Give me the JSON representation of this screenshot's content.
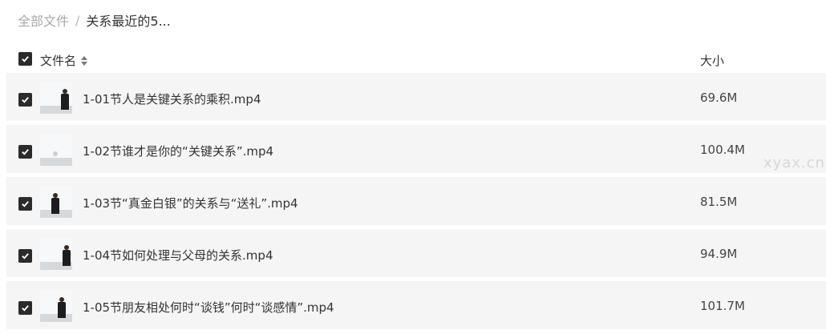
{
  "breadcrumb": {
    "root": "全部文件",
    "separator": "/",
    "current": "关系最近的5..."
  },
  "header": {
    "name_label": "文件名",
    "size_label": "大小",
    "all_checked": true
  },
  "files": [
    {
      "name": "1-01节人是关键关系的乘积.mp4",
      "size": "69.6M",
      "checked": true
    },
    {
      "name": "1-02节谁才是你的“关键关系”.mp4",
      "size": "100.4M",
      "checked": true
    },
    {
      "name": "1-03节“真金白银”的关系与“送礼”.mp4",
      "size": "81.5M",
      "checked": true
    },
    {
      "name": "1-04节如何处理与父母的关系.mp4",
      "size": "94.9M",
      "checked": true
    },
    {
      "name": "1-05节朋友相处何时“谈钱”何时“谈感情”.mp4",
      "size": "101.7M",
      "checked": true
    }
  ],
  "watermark": "xyax.cn",
  "colors": {
    "row_bg": "#f5f5f6",
    "checkbox": "#2b2b2b",
    "breadcrumb_root": "#a8a8a8"
  }
}
